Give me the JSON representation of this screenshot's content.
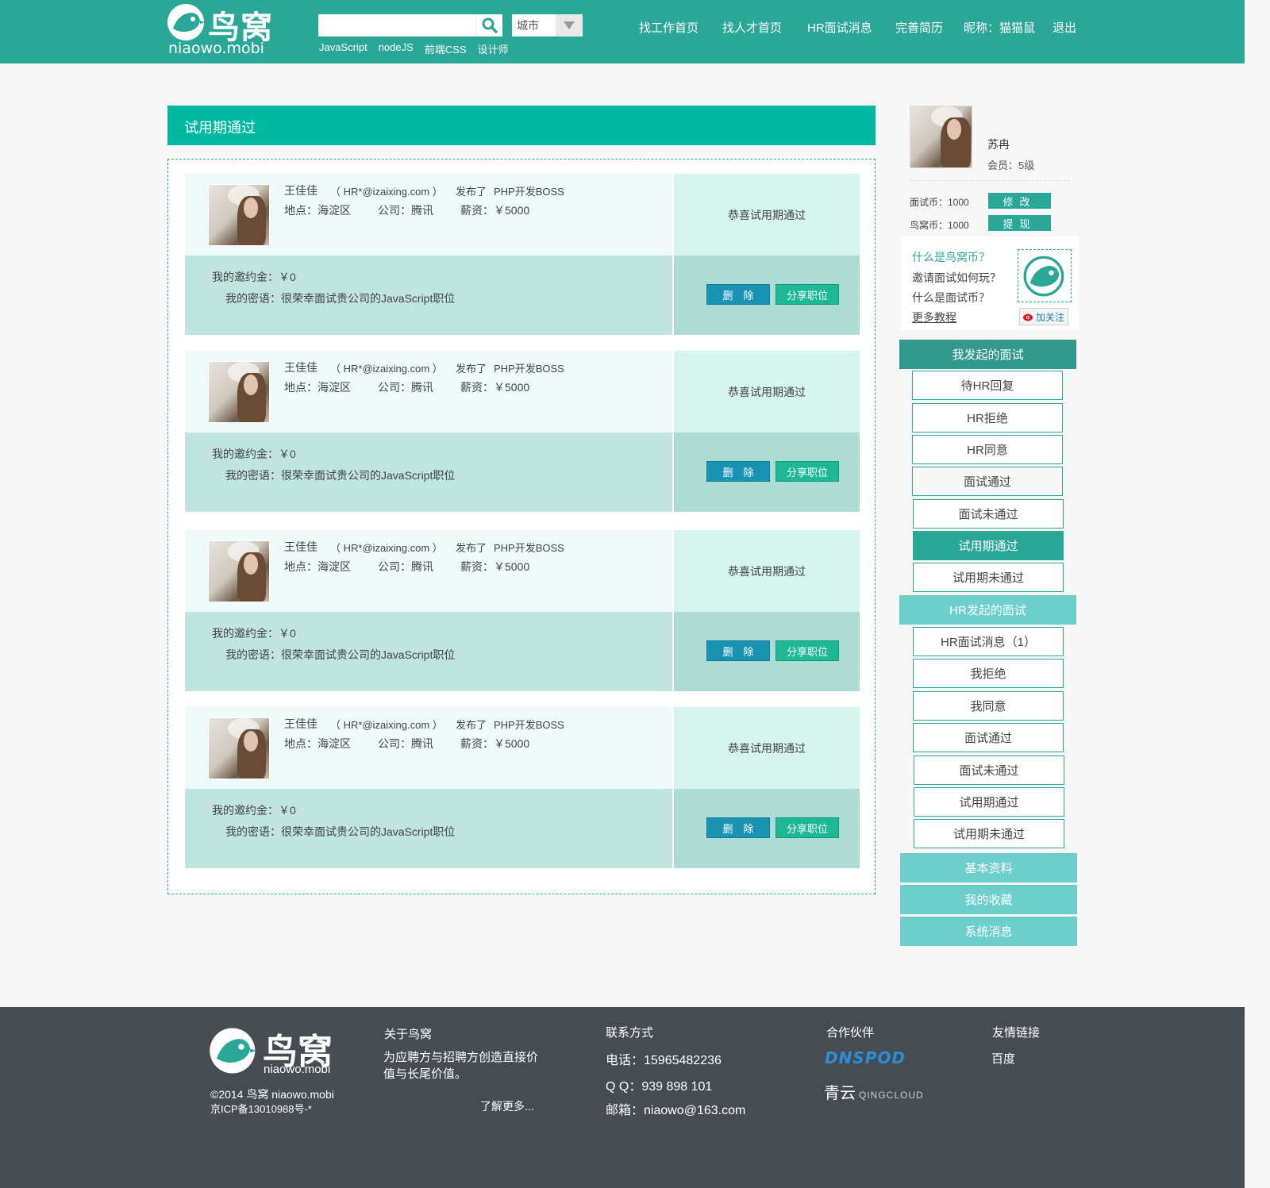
{
  "header": {
    "logo_cn": "鸟窝",
    "logo_en": "niaowo.mobi",
    "search_placeholder": "",
    "city_label": "城市",
    "hot_tags": [
      "JavaScript",
      "nodeJS",
      "前端CSS",
      "设计师"
    ],
    "nav": [
      "找工作首页",
      "找人才首页",
      "HR面试消息",
      "完善简历",
      "昵称：猫猫鼠",
      "退出"
    ]
  },
  "main": {
    "section_title": "试用期通过",
    "cards": [
      {
        "name": "王佳佳",
        "email": "（ HR*@izaixing.com ）",
        "posted_prefix": "发布了",
        "job": "PHP开发BOSS",
        "location": "地点：海淀区",
        "company": "公司：腾讯",
        "salary": "薪资：￥5000",
        "status": "恭喜试用期通过",
        "deposit": "我的邀约金：￥0",
        "password": "我的密语：很荣幸面试贵公司的JavaScript职位",
        "delete_label": "删　除",
        "share_label": "分享职位"
      },
      {
        "name": "王佳佳",
        "email": "（ HR*@izaixing.com ）",
        "posted_prefix": "发布了",
        "job": "PHP开发BOSS",
        "location": "地点：海淀区",
        "company": "公司：腾讯",
        "salary": "薪资：￥5000",
        "status": "恭喜试用期通过",
        "deposit": "我的邀约金：￥0",
        "password": "我的密语：很荣幸面试贵公司的JavaScript职位",
        "delete_label": "删　除",
        "share_label": "分享职位"
      },
      {
        "name": "王佳佳",
        "email": "（ HR*@izaixing.com ）",
        "posted_prefix": "发布了",
        "job": "PHP开发BOSS",
        "location": "地点：海淀区",
        "company": "公司：腾讯",
        "salary": "薪资：￥5000",
        "status": "恭喜试用期通过",
        "deposit": "我的邀约金：￥0",
        "password": "我的密语：很荣幸面试贵公司的JavaScript职位",
        "delete_label": "删　除",
        "share_label": "分享职位"
      },
      {
        "name": "王佳佳",
        "email": "（ HR*@izaixing.com ）",
        "posted_prefix": "发布了",
        "job": "PHP开发BOSS",
        "location": "地点：海淀区",
        "company": "公司：腾讯",
        "salary": "薪资：￥5000",
        "status": "恭喜试用期通过",
        "deposit": "我的邀约金：￥0",
        "password": "我的密语：很荣幸面试贵公司的JavaScript职位",
        "delete_label": "删　除",
        "share_label": "分享职位"
      }
    ]
  },
  "sidebar": {
    "profile_name": "苏冉",
    "profile_level": "会员：5级",
    "interview_coin": "面试币：1000",
    "nest_coin": "鸟窝币：1000",
    "modify_label": "修改",
    "withdraw_label": "提现",
    "faq": [
      "什么是鸟窝币？",
      "邀请面试如何玩？",
      "什么是面试币？",
      "更多教程"
    ],
    "follow_label": "加关注",
    "my_interviews_head": "我发起的面试",
    "my_interviews": [
      "待HR回复",
      "HR拒绝",
      "HR同意",
      "面试通过",
      "面试未通过",
      "试用期通过",
      "试用期未通过"
    ],
    "hr_interviews_head": "HR发起的面试",
    "hr_interviews": [
      "HR面试消息（1）",
      "我拒绝",
      "我同意",
      "面试通过",
      "面试未通过",
      "试用期通过",
      "试用期未通过"
    ],
    "blocks": [
      "基本资料",
      "我的收藏",
      "系统消息"
    ]
  },
  "footer": {
    "logo_cn": "鸟窝",
    "logo_en": "niaowo.mobi",
    "copyright": "©2014 鸟窝 niaowo.mobi",
    "icp": "京ICP备13010988号-*",
    "about_title": "关于鸟窝",
    "about_body": "为应聘方与招聘方创造直接价值与长尾价值。",
    "about_more": "了解更多...",
    "contact_title": "联系方式",
    "phone": "电话：15965482236",
    "qq": "Q Q：939 898 101",
    "email": "邮箱：niaowo@163.com",
    "partners_title": "合作伙伴",
    "partner1": "DNSPOD",
    "partner2_cn": "青云",
    "partner2_en": "QINGCLOUD",
    "links_title": "友情链接",
    "link1": "百度"
  },
  "colors": {
    "brand": "#2aa797",
    "title_bar": "#00b9a0",
    "delete_btn": "#1a93b3",
    "share_btn": "#1db896",
    "footer_bg": "#474c52"
  }
}
